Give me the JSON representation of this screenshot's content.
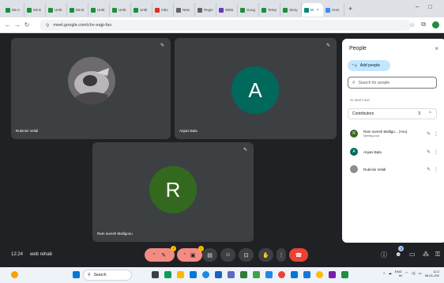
{
  "browser": {
    "tabs": [
      {
        "label": "Ms A",
        "color": "#1e8e3e"
      },
      {
        "label": "Ms E",
        "color": "#1e8e3e"
      },
      {
        "label": "Untit",
        "color": "#1e8e3e"
      },
      {
        "label": "Ms B",
        "color": "#1e8e3e"
      },
      {
        "label": "Untit",
        "color": "#1e8e3e"
      },
      {
        "label": "Untit",
        "color": "#1e8e3e"
      },
      {
        "label": "Untit",
        "color": "#1e8e3e"
      },
      {
        "label": "Inbo",
        "color": "#d93025"
      },
      {
        "label": "New",
        "color": "#5f6368"
      },
      {
        "label": "Regis",
        "color": "#5f6368"
      },
      {
        "label": "WEB",
        "color": "#673ab7"
      },
      {
        "label": "Goog",
        "color": "#1e8e3e"
      },
      {
        "label": "Temp",
        "color": "#1e8e3e"
      },
      {
        "label": "Story",
        "color": "#1e8e3e"
      }
    ],
    "active_tab": {
      "label": "M"
    },
    "last_tab": {
      "label": "Hom"
    },
    "new_tab": "+",
    "url": "meet.google.com/chv-eajp-fas"
  },
  "meet": {
    "tiles": [
      {
        "name": "Rukmini Velidi",
        "avatar_color": "#8d8d8d"
      },
      {
        "name": "Anjani Bala",
        "avatar_letter": "A",
        "avatar_color": "#00695c"
      },
      {
        "name": "Ram suresh Malligonu",
        "avatar_letter": "R",
        "avatar_color": "#33691e"
      }
    ],
    "clock": "12:24",
    "meeting_name": "web rehab",
    "controls": {
      "mic_badge": "!",
      "cam_badge": "!",
      "people_count": "3"
    }
  },
  "people_panel": {
    "title": "People",
    "close": "×",
    "add_people": "Add people",
    "search_placeholder": "Search for people",
    "section": "IN MEETING",
    "group": {
      "label": "Contributors",
      "count": "3",
      "chevron": "^"
    },
    "people": [
      {
        "name": "Ram suresh Malligo... (You)",
        "sub": "Meeting host",
        "letter": "R",
        "color": "#33691e"
      },
      {
        "name": "Anjani Bala",
        "sub": "",
        "letter": "A",
        "color": "#00695c"
      },
      {
        "name": "Rukmini Velidi",
        "sub": "",
        "letter": "",
        "color": "#8d8d8d"
      }
    ]
  },
  "taskbar": {
    "search": "Search",
    "lang_top": "ENG",
    "lang_bottom": "IN",
    "time": "12:2",
    "date": "06-01-202"
  }
}
